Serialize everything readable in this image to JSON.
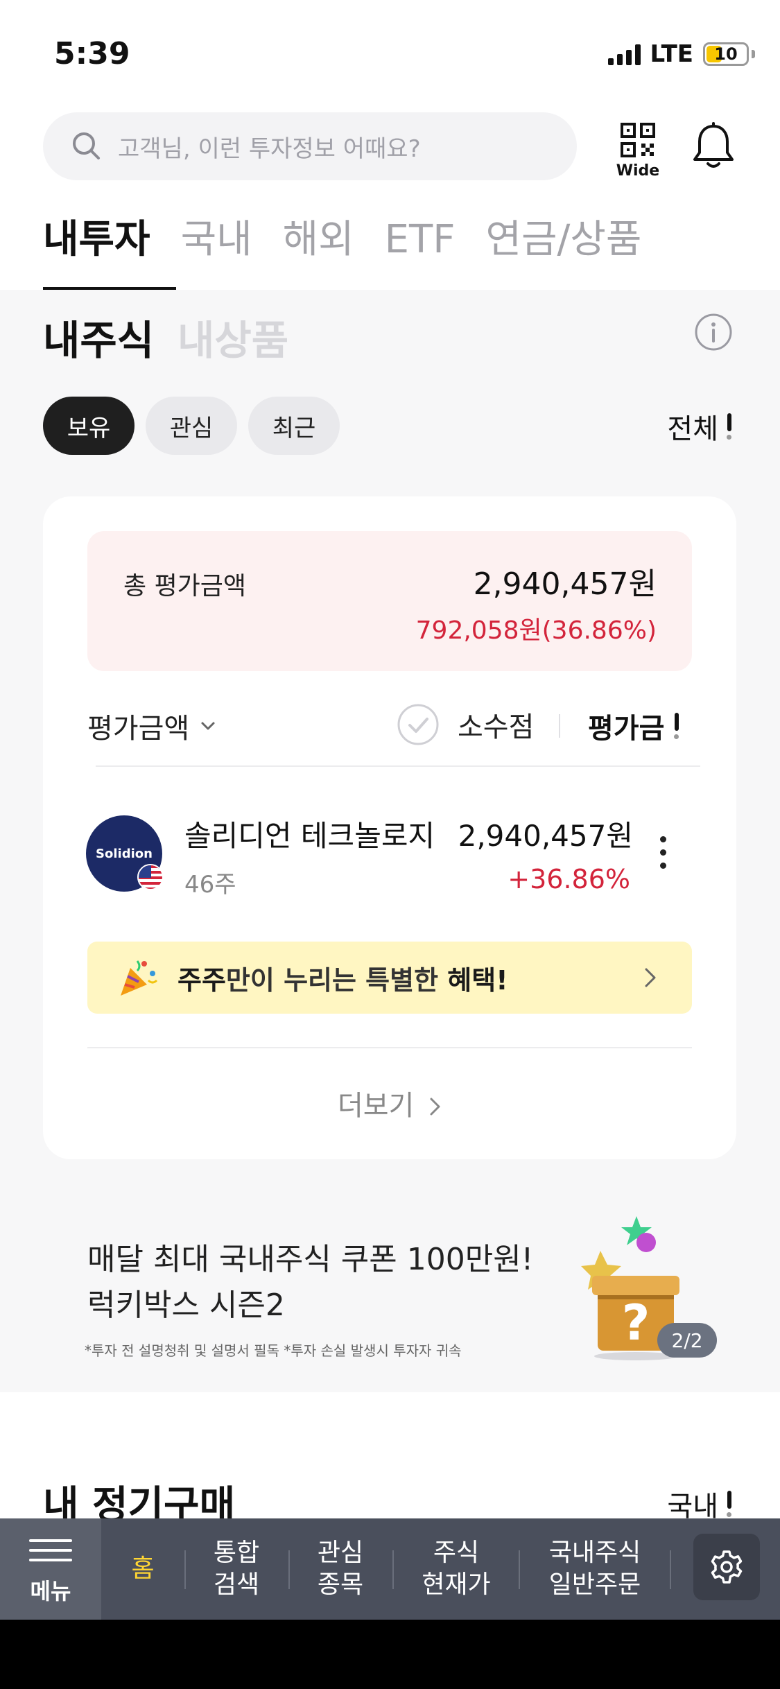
{
  "status_bar": {
    "time": "5:39",
    "network": "LTE",
    "battery": "10"
  },
  "search": {
    "placeholder": "고객님, 이런 투자정보 어때요?"
  },
  "qr": {
    "label": "Wide"
  },
  "main_tabs": [
    "내투자",
    "국내",
    "해외",
    "ETF",
    "연금/상품"
  ],
  "sub_tabs": {
    "my_stocks": "내주식",
    "my_products": "내상품"
  },
  "chips": [
    "보유",
    "관심",
    "최근"
  ],
  "filter": {
    "label": "전체"
  },
  "summary": {
    "label": "총 평가금액",
    "total": "2,940,457원",
    "change": "792,058원(36.86%)"
  },
  "list_header": {
    "sort_label": "평가금액",
    "decimal_label": "소수점",
    "eval_label": "평가금"
  },
  "stock": {
    "logo_text": "Solidion",
    "name": "솔리디언 테크놀로지",
    "quantity": "46주",
    "value": "2,940,457원",
    "change": "+36.86%"
  },
  "promo": {
    "bold1": "주주",
    "text1": "만이 누리는 특별한 ",
    "bold2": "혜택!"
  },
  "more_link": "더보기",
  "lucky": {
    "title1": "매달 최대 국내주식 쿠폰 100만원!",
    "title2": "럭키박스 시즌2",
    "disclaimer": "*투자 전 설명청취 및 설명서 필독  *투자 손실 발생시 투자자 귀속",
    "page": "2/2"
  },
  "regular": {
    "title": "내 정기구매",
    "filter": "국내"
  },
  "bottom_nav": {
    "menu": "메뉴",
    "items": [
      "홈",
      "통합\n검색",
      "관심\n종목",
      "주식\n현재가",
      "국내주식\n일반주문"
    ]
  },
  "colors": {
    "negative_red": "#d3243b",
    "nav_active": "#ffd633",
    "nav_bg": "#4a4f5c"
  }
}
